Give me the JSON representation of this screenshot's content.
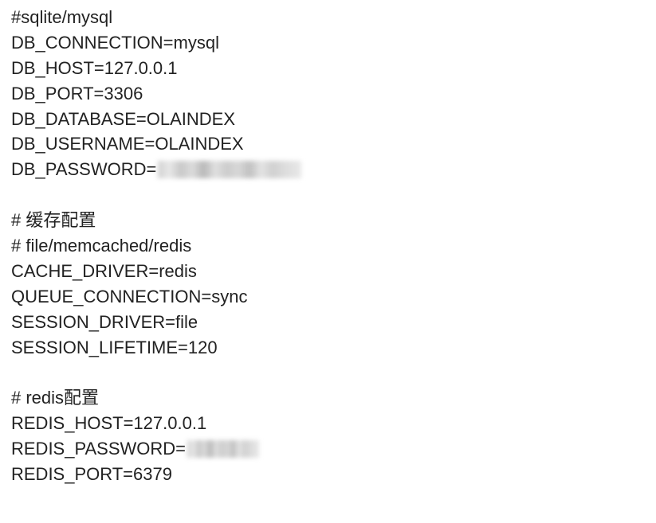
{
  "lines": {
    "l1": "#sqlite/mysql",
    "l2": "DB_CONNECTION=mysql",
    "l3": "DB_HOST=127.0.0.1",
    "l4": "DB_PORT=3306",
    "l5": "DB_DATABASE=OLAINDEX",
    "l6": "DB_USERNAME=OLAINDEX",
    "l7_prefix": "DB_PASSWORD=",
    "l8": "",
    "l9": "# 缓存配置",
    "l10": "# file/memcached/redis",
    "l11": "CACHE_DRIVER=redis",
    "l12": "QUEUE_CONNECTION=sync",
    "l13": "SESSION_DRIVER=file",
    "l14": "SESSION_LIFETIME=120",
    "l15": "",
    "l16": "# redis配置",
    "l17": "REDIS_HOST=127.0.0.1",
    "l18_prefix": "REDIS_PASSWORD=",
    "l19": "REDIS_PORT=6379"
  }
}
